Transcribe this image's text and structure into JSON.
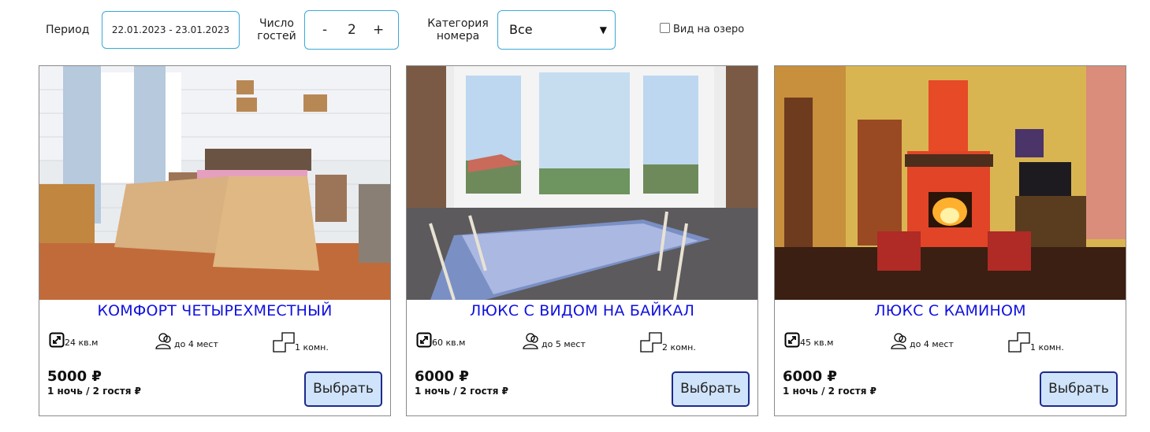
{
  "filters": {
    "period_label": "Период",
    "period_value": "22.01.2023 - 23.01.2023",
    "guests_label_line1": "Число",
    "guests_label_line2": "гостей",
    "guests_minus": "-",
    "guests_value": "2",
    "guests_plus": "+",
    "category_label_line1": "Категория",
    "category_label_line2": "номера",
    "category_value": "Все",
    "lake_view_label": "Вид на озеро",
    "lake_view_checked": false
  },
  "rooms": [
    {
      "title": "КОМФОРТ ЧЕТЫРЕХМЕСТНЫЙ",
      "area": "24 кв.м",
      "guests": "до 4 мест",
      "rooms": "1 комн.",
      "price": "5000 ₽",
      "price_note": "1 ночь / 2 гостя ₽",
      "button": "Выбрать"
    },
    {
      "title": "ЛЮКС С ВИДОМ НА БАЙКАЛ",
      "area": "60 кв.м",
      "guests": "до 5 мест",
      "rooms": "2 комн.",
      "price": "6000 ₽",
      "price_note": "1 ночь / 2 гостя ₽",
      "button": "Выбрать"
    },
    {
      "title": "ЛЮКС С КАМИНОМ",
      "area": "45 кв.м",
      "guests": "до 4 мест",
      "rooms": "1 комн.",
      "price": "6000 ₽",
      "price_note": "1 ночь / 2 гостя ₽",
      "button": "Выбрать"
    }
  ],
  "colors": {
    "accent_border": "#3aa9d6",
    "title_blue": "#1010e0",
    "button_bg": "#cfe3fb",
    "button_border": "#1c2a8c"
  }
}
